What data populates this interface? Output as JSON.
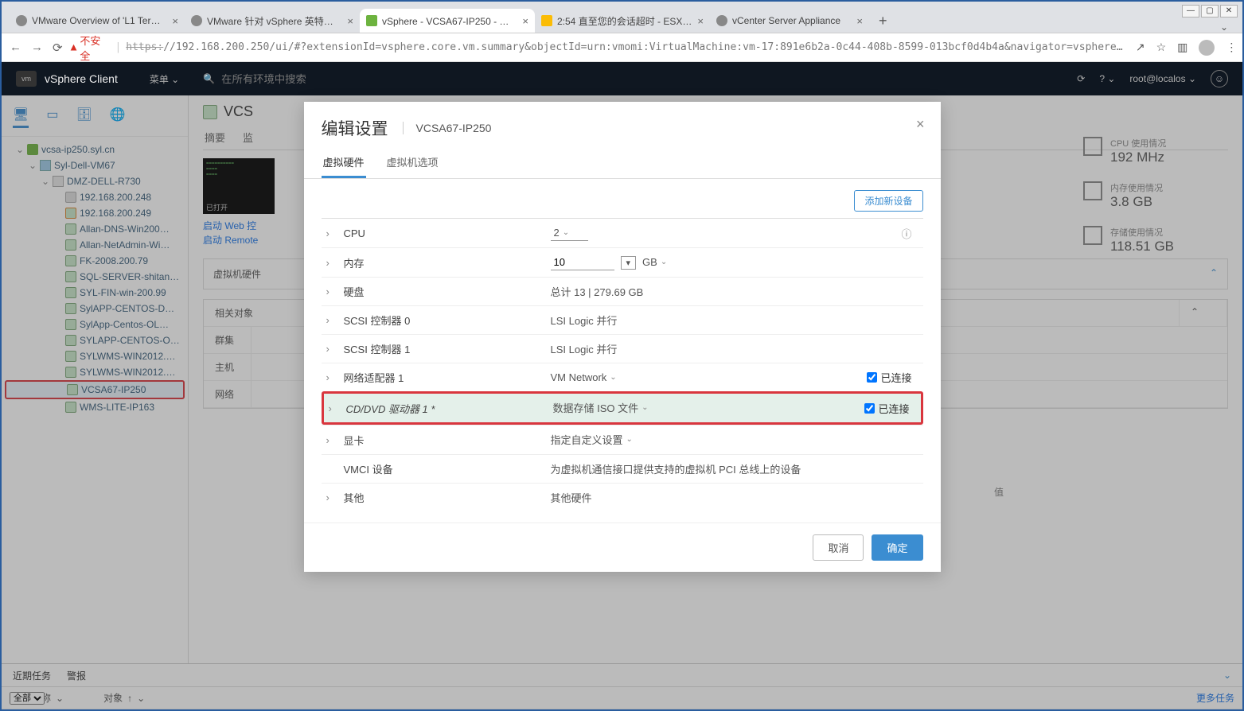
{
  "window_controls": {
    "min": "—",
    "max": "▢",
    "close": "✕"
  },
  "tabs": [
    {
      "title": "VMware Overview of 'L1 Term…"
    },
    {
      "title": "VMware 针对 vSphere 英特尔处…"
    },
    {
      "title": "vSphere - VCSA67-IP250 - 摘要",
      "active": true
    },
    {
      "title": "2:54 直至您的会话超时 - ESXi…"
    },
    {
      "title": "vCenter Server Appliance"
    }
  ],
  "addrbar": {
    "insecure": "不安全",
    "url_scheme": "https:",
    "url_rest": "//192.168.200.250/ui/#?extensionId=vsphere.core.vm.summary&objectId=urn:vmomi:VirtualMachine:vm-17:891e6b2a-0c44-408b-8599-013bcf0d4b4a&navigator=vsphere.cor…"
  },
  "vsheader": {
    "logo": "vm",
    "brand": "vSphere Client",
    "menu": "菜单 ⌄",
    "search_placeholder": "在所有环境中搜索",
    "refresh": "⟳",
    "help": "?",
    "user": "root@localos",
    "face": "☺"
  },
  "tree": [
    {
      "pad": "pad1",
      "tog": "⌄",
      "ic": "vc",
      "label": "vcsa-ip250.syl.cn"
    },
    {
      "pad": "pad2",
      "tog": "⌄",
      "ic": "dc",
      "label": "Syl-Dell-VM67"
    },
    {
      "pad": "pad3",
      "tog": "⌄",
      "ic": "host",
      "label": "DMZ-DELL-R730"
    },
    {
      "pad": "pad4",
      "tog": "",
      "ic": "vm-off",
      "label": "192.168.200.248"
    },
    {
      "pad": "pad4",
      "tog": "",
      "ic": "vm-warn",
      "label": "192.168.200.249"
    },
    {
      "pad": "pad4",
      "tog": "",
      "ic": "vm",
      "label": "Allan-DNS-Win200…"
    },
    {
      "pad": "pad4",
      "tog": "",
      "ic": "vm",
      "label": "Allan-NetAdmin-Wi…"
    },
    {
      "pad": "pad4",
      "tog": "",
      "ic": "vm",
      "label": "FK-2008.200.79"
    },
    {
      "pad": "pad4",
      "tog": "",
      "ic": "vm",
      "label": "SQL-SERVER-shitan…"
    },
    {
      "pad": "pad4",
      "tog": "",
      "ic": "vm",
      "label": "SYL-FIN-win-200.99"
    },
    {
      "pad": "pad4",
      "tog": "",
      "ic": "vm",
      "label": "SylAPP-CENTOS-D…"
    },
    {
      "pad": "pad4",
      "tog": "",
      "ic": "vm",
      "label": "SylApp-Centos-OL…"
    },
    {
      "pad": "pad4",
      "tog": "",
      "ic": "vm",
      "label": "SYLAPP-CENTOS-O…"
    },
    {
      "pad": "pad4",
      "tog": "",
      "ic": "vm",
      "label": "SYLWMS-WIN2012.…"
    },
    {
      "pad": "pad4",
      "tog": "",
      "ic": "vm",
      "label": "SYLWMS-WIN2012.…"
    },
    {
      "pad": "pad4",
      "tog": "",
      "ic": "vm",
      "label": "VCSA67-IP250",
      "selected": true
    },
    {
      "pad": "pad4",
      "tog": "",
      "ic": "vm",
      "label": "WMS-LITE-IP163"
    }
  ],
  "page": {
    "title_prefix": "VCS",
    "tabs": [
      "摘要",
      "监"
    ],
    "thumb_label": "已打开",
    "links": [
      "启动 Web 控",
      "启动 Remote"
    ],
    "panel1": "虚拟机硬件",
    "panel2": "相关对象",
    "rel_rows": [
      "群集",
      "主机",
      "网络"
    ],
    "valcol": "值"
  },
  "stats": [
    {
      "label": "CPU 使用情况",
      "value": "192 MHz"
    },
    {
      "label": "内存使用情况",
      "value": "3.8 GB"
    },
    {
      "label": "存储使用情况",
      "value": "118.51 GB"
    }
  ],
  "modal": {
    "title": "编辑设置",
    "subtitle": "VCSA67-IP250",
    "tabs": [
      "虚拟硬件",
      "虚拟机选项"
    ],
    "add_device": "添加新设备",
    "rows": {
      "cpu": {
        "label": "CPU",
        "value": "2"
      },
      "mem": {
        "label": "内存",
        "value": "10",
        "unit": "GB"
      },
      "disk": {
        "label": "硬盘",
        "value": "总计 13 | 279.69 GB"
      },
      "scsi0": {
        "label": "SCSI 控制器 0",
        "value": "LSI Logic 并行"
      },
      "scsi1": {
        "label": "SCSI 控制器 1",
        "value": "LSI Logic 并行"
      },
      "net": {
        "label": "网络适配器 1",
        "value": "VM Network",
        "chk": "已连接"
      },
      "cd": {
        "label": "CD/DVD 驱动器 1 *",
        "value": "数据存储 ISO 文件",
        "chk": "已连接"
      },
      "vga": {
        "label": "显卡",
        "value": "指定自定义设置"
      },
      "vmci": {
        "label": "VMCI 设备",
        "value": "为虚拟机通信接口提供支持的虚拟机 PCI 总线上的设备"
      },
      "other": {
        "label": "其他",
        "value": "其他硬件"
      }
    },
    "cancel": "取消",
    "ok": "确定"
  },
  "tasks": {
    "recent": "近期任务",
    "alarms": "警报",
    "col1": "任务名称",
    "col2": "对象",
    "filter": "全部",
    "more": "更多任务"
  }
}
